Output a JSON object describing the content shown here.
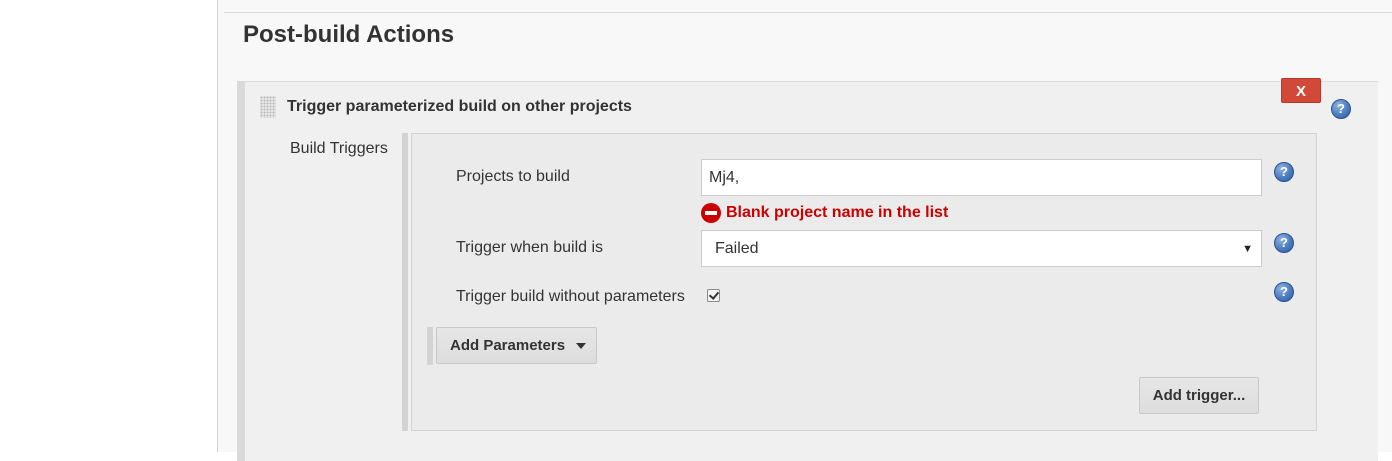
{
  "section": {
    "title": "Post-build Actions"
  },
  "action": {
    "title": "Trigger parameterized build on other projects",
    "delete_label": "X",
    "help_glyph": "?"
  },
  "build_triggers": {
    "label": "Build Triggers",
    "projects": {
      "label": "Projects to build",
      "value": "Mj4,",
      "error": "Blank project name in the list"
    },
    "condition": {
      "label": "Trigger when build is",
      "selected": "Failed"
    },
    "no_params": {
      "label": "Trigger build without parameters",
      "checked": true
    },
    "add_parameters_label": "Add Parameters",
    "add_trigger_label": "Add trigger..."
  },
  "colors": {
    "error": "#cc0000",
    "delete_button": "#d24939",
    "help_icon": "#4a7cc0"
  },
  "icons": {
    "help": "help-icon",
    "error": "error-icon",
    "drag": "drag-handle-icon",
    "dropdown": "chevron-down-icon"
  }
}
